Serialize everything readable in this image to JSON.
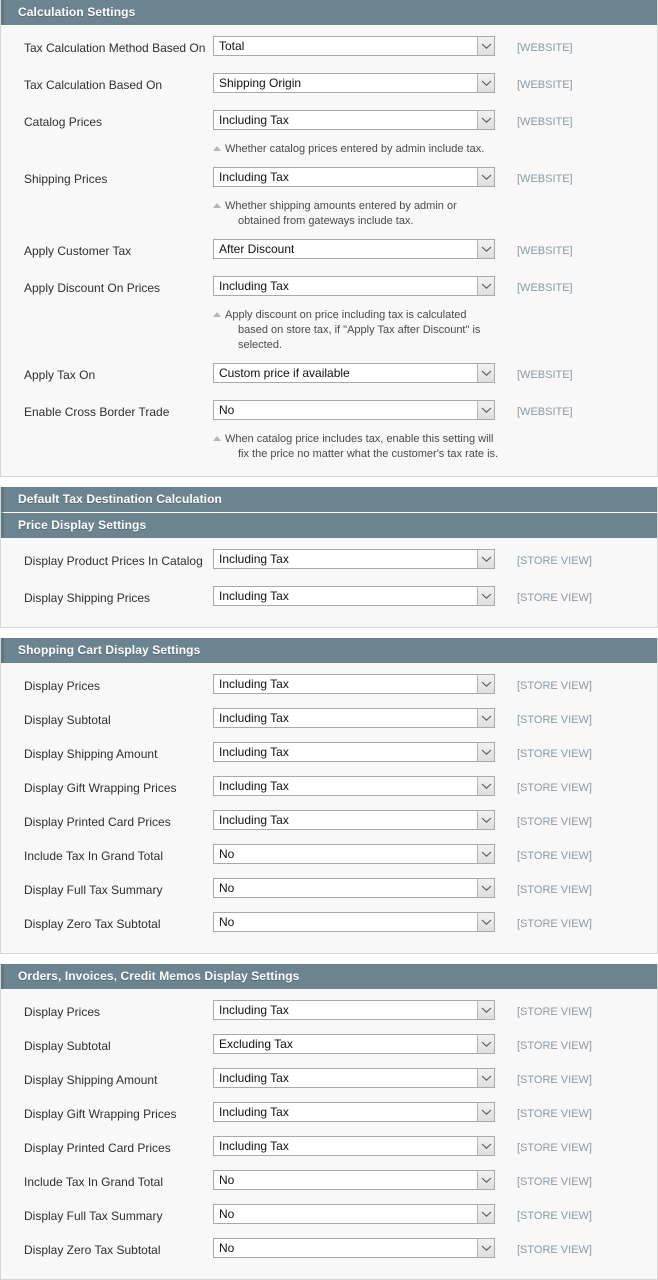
{
  "colors": {
    "header_bg": "#6b848f",
    "panel_bg": "#f8f8f8",
    "scope_text": "#8a9aa5",
    "label_text": "#2f2f2f"
  },
  "scopes": {
    "website": "[WEBSITE]",
    "store_view": "[STORE VIEW]"
  },
  "sections": [
    {
      "id": "calculation-settings",
      "title": "Calculation Settings",
      "fields": [
        {
          "label": "Tax Calculation Method Based On",
          "value": "Total",
          "scope": "[WEBSITE]"
        },
        {
          "label": "Tax Calculation Based On",
          "value": "Shipping Origin",
          "scope": "[WEBSITE]"
        },
        {
          "label": "Catalog Prices",
          "value": "Including Tax",
          "scope": "[WEBSITE]",
          "hint": [
            "Whether catalog prices entered by admin include tax."
          ]
        },
        {
          "label": "Shipping Prices",
          "value": "Including Tax",
          "scope": "[WEBSITE]",
          "hint": [
            "Whether shipping amounts entered by admin or",
            "obtained from gateways include tax."
          ]
        },
        {
          "label": "Apply Customer Tax",
          "value": "After Discount",
          "scope": "[WEBSITE]"
        },
        {
          "label": "Apply Discount On Prices",
          "value": "Including Tax",
          "scope": "[WEBSITE]",
          "hint": [
            "Apply discount on price including tax is calculated",
            "based on store tax, if \"Apply Tax after Discount\" is",
            "selected."
          ]
        },
        {
          "label": "Apply Tax On",
          "value": "Custom price if available",
          "scope": "[WEBSITE]"
        },
        {
          "label": "Enable Cross Border Trade",
          "value": "No",
          "scope": "[WEBSITE]",
          "hint": [
            "When catalog price includes tax, enable this setting will",
            "fix the price no matter what the customer's tax rate is."
          ]
        }
      ]
    },
    {
      "id": "default-tax-destination-calculation",
      "title": "Default Tax Destination Calculation",
      "collapsed": true,
      "fields": []
    },
    {
      "id": "price-display-settings",
      "title": "Price Display Settings",
      "fields": [
        {
          "label": "Display Product Prices In Catalog",
          "value": "Including Tax",
          "scope": "[STORE VIEW]"
        },
        {
          "label": "Display Shipping Prices",
          "value": "Including Tax",
          "scope": "[STORE VIEW]"
        }
      ]
    },
    {
      "id": "shopping-cart-display-settings",
      "title": "Shopping Cart Display Settings",
      "fields": [
        {
          "label": "Display Prices",
          "value": "Including Tax",
          "scope": "[STORE VIEW]"
        },
        {
          "label": "Display Subtotal",
          "value": "Including Tax",
          "scope": "[STORE VIEW]"
        },
        {
          "label": "Display Shipping Amount",
          "value": "Including Tax",
          "scope": "[STORE VIEW]"
        },
        {
          "label": "Display Gift Wrapping Prices",
          "value": "Including Tax",
          "scope": "[STORE VIEW]"
        },
        {
          "label": "Display Printed Card Prices",
          "value": "Including Tax",
          "scope": "[STORE VIEW]"
        },
        {
          "label": "Include Tax In Grand Total",
          "value": "No",
          "scope": "[STORE VIEW]"
        },
        {
          "label": "Display Full Tax Summary",
          "value": "No",
          "scope": "[STORE VIEW]"
        },
        {
          "label": "Display Zero Tax Subtotal",
          "value": "No",
          "scope": "[STORE VIEW]"
        }
      ]
    },
    {
      "id": "orders-invoices-credit-memos-display-settings",
      "title": "Orders, Invoices, Credit Memos Display Settings",
      "fields": [
        {
          "label": "Display Prices",
          "value": "Including Tax",
          "scope": "[STORE VIEW]"
        },
        {
          "label": "Display Subtotal",
          "value": "Excluding Tax",
          "scope": "[STORE VIEW]"
        },
        {
          "label": "Display Shipping Amount",
          "value": "Including Tax",
          "scope": "[STORE VIEW]"
        },
        {
          "label": "Display Gift Wrapping Prices",
          "value": "Including Tax",
          "scope": "[STORE VIEW]"
        },
        {
          "label": "Display Printed Card Prices",
          "value": "Including Tax",
          "scope": "[STORE VIEW]"
        },
        {
          "label": "Include Tax In Grand Total",
          "value": "No",
          "scope": "[STORE VIEW]"
        },
        {
          "label": "Display Full Tax Summary",
          "value": "No",
          "scope": "[STORE VIEW]"
        },
        {
          "label": "Display Zero Tax Subtotal",
          "value": "No",
          "scope": "[STORE VIEW]"
        }
      ]
    }
  ]
}
